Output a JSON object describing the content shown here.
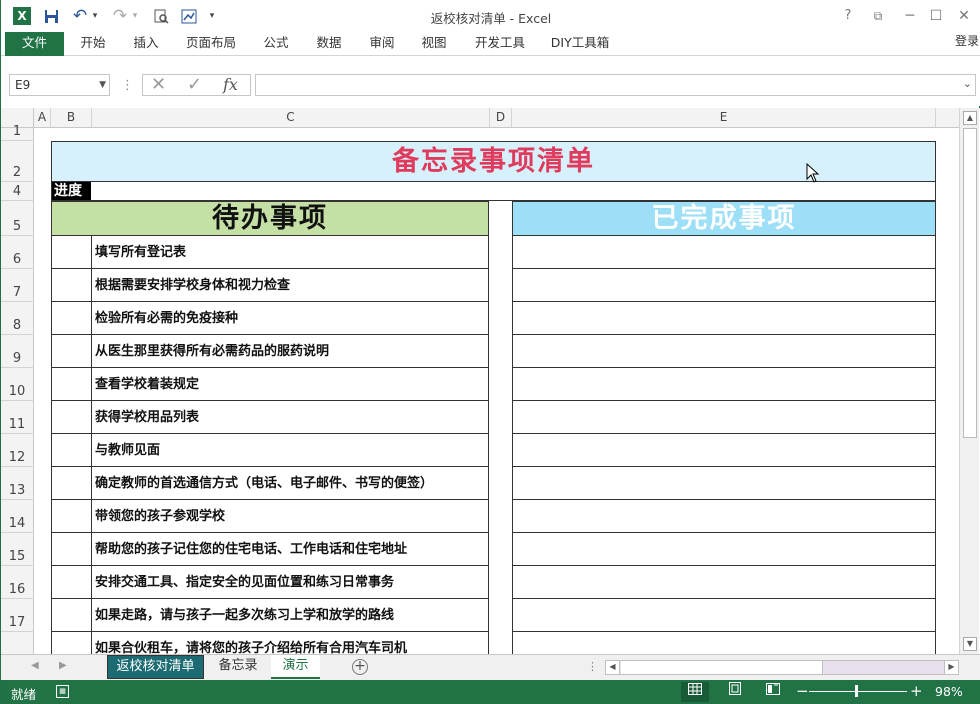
{
  "window": {
    "title": "返校核对清单 - Excel",
    "help": "?",
    "restore_ribbon": "⧉",
    "minimize": "─",
    "maximize": "☐",
    "close": "✕"
  },
  "qat": {
    "excel_logo": "X",
    "save": "💾",
    "undo": "↶",
    "redo": "↷",
    "print_preview": "🔍",
    "custom": "⊞",
    "more": "▾"
  },
  "ribbon": {
    "tabs": [
      "文件",
      "开始",
      "插入",
      "页面布局",
      "公式",
      "数据",
      "审阅",
      "视图",
      "开发工具",
      "DIY工具箱"
    ],
    "login": "登录"
  },
  "formula_bar": {
    "name_box": "E9",
    "separator": "⋮",
    "cancel": "✕",
    "enter": "✓",
    "fx": "fx",
    "formula": ""
  },
  "columns": [
    "A",
    "B",
    "C",
    "D",
    "E"
  ],
  "rows": [
    "1",
    "2",
    "4",
    "5",
    "6",
    "7",
    "8",
    "9",
    "10",
    "11",
    "12",
    "13",
    "14",
    "15",
    "16",
    "17",
    "18"
  ],
  "sheet": {
    "title": "备忘录事项清单",
    "progress_label": "进度",
    "todo_header": "待办事项",
    "done_header": "已完成事项",
    "tasks": [
      "填写所有登记表",
      "根据需要安排学校身体和视力检查",
      "检验所有必需的免疫接种",
      "从医生那里获得所有必需药品的服药说明",
      "查看学校着装规定",
      "获得学校用品列表",
      "与教师见面",
      "确定教师的首选通信方式（电话、电子邮件、书写的便签）",
      "带领您的孩子参观学校",
      "帮助您的孩子记住您的住宅电话、工作电话和住宅地址",
      "安排交通工具、指定安全的见面位置和练习日常事务",
      "如果走路，请与孩子一起多次练习上学和放学的路线",
      "如果合伙租车，请将您的孩子介绍给所有合用汽车司机"
    ]
  },
  "sheet_tabs": [
    "返校核对清单",
    "备忘录",
    "演示"
  ],
  "status": {
    "ready": "就绪",
    "zoom": "98%"
  },
  "colors": {
    "excel_green": "#217346",
    "title_fill": "#d6f1fb",
    "title_text": "#e03a5c",
    "todo_fill": "#c5e0a5",
    "done_fill": "#9ddff6",
    "active_tab": "#1d6b72"
  }
}
